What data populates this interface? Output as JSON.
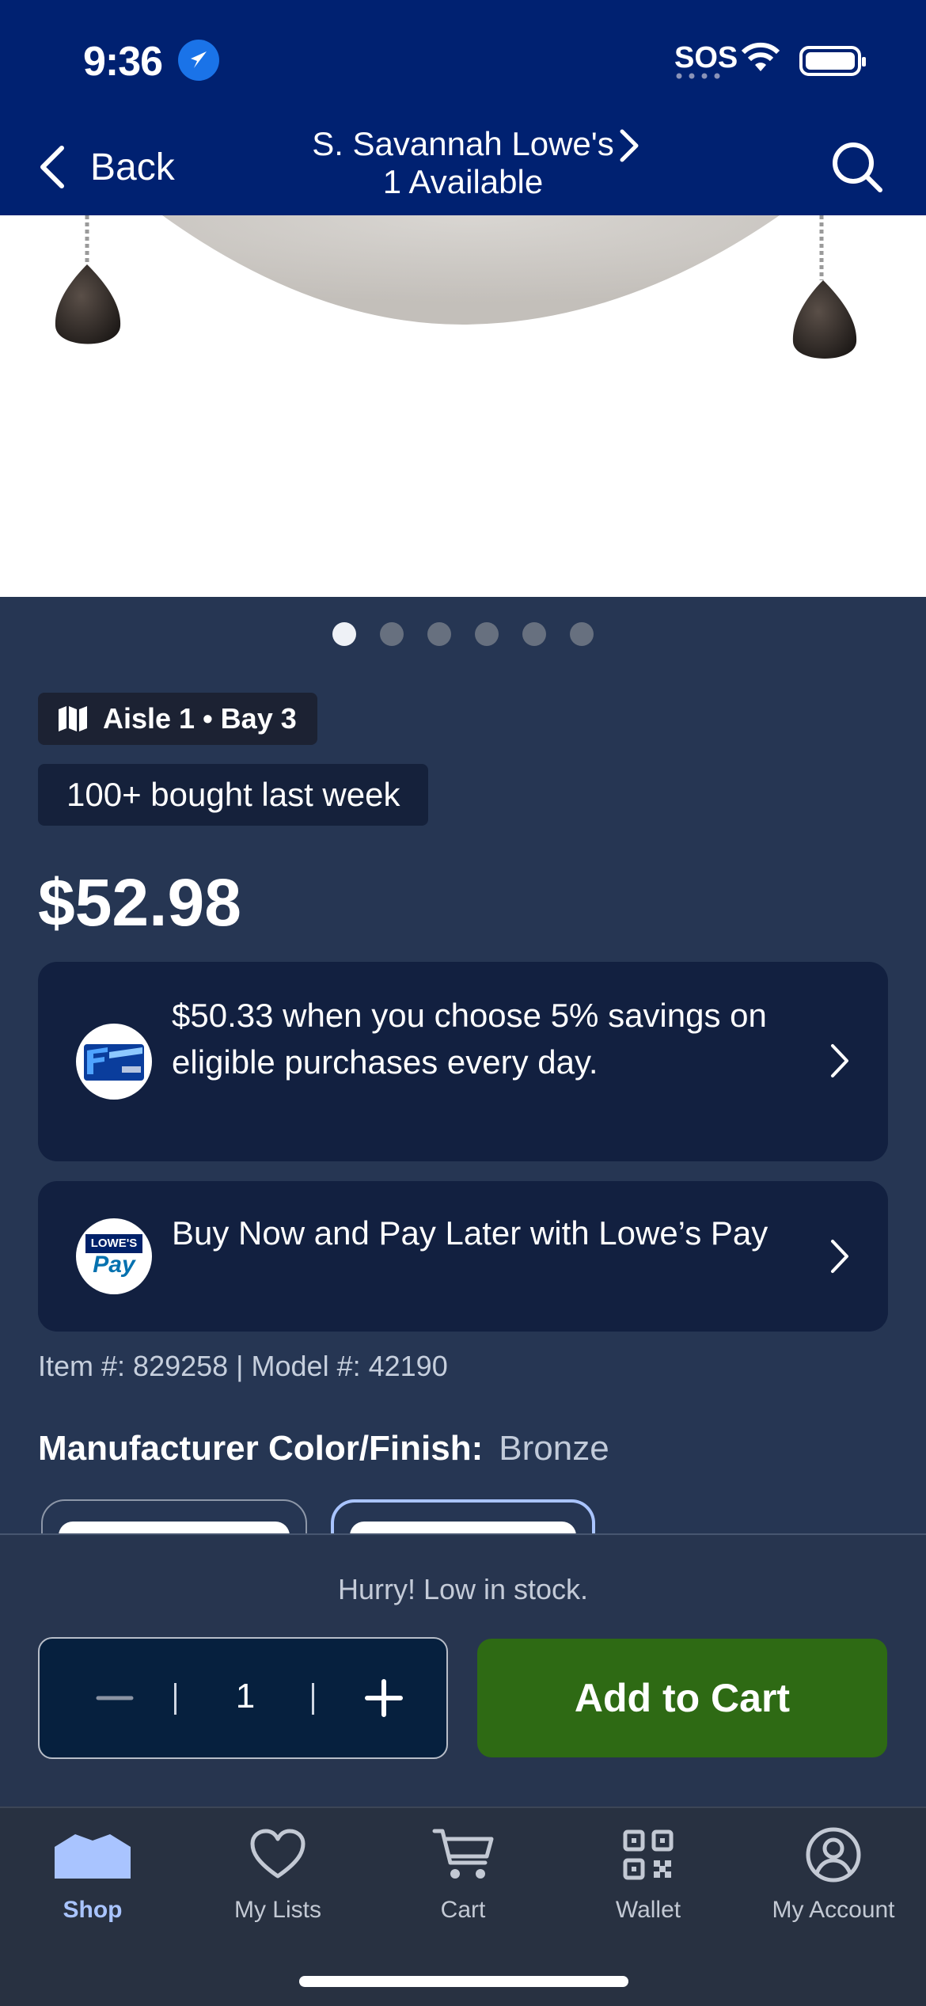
{
  "status_bar": {
    "time": "9:36",
    "sos": "SOS"
  },
  "header": {
    "back_label": "Back",
    "store_name": "S. Savannah Lowe's",
    "availability": "1 Available"
  },
  "gallery": {
    "total": 6,
    "active_index": 0
  },
  "product": {
    "location": "Aisle 1 • Bay 3",
    "social_proof": "100+ bought last week",
    "price": "$52.98",
    "offer_card": "$50.33 when you choose 5% savings on eligible purchases every day.",
    "pay_card": "Buy Now and Pay Later with Lowe’s Pay",
    "pay_logo_top": "LOWE'S",
    "pay_logo_bottom": "Pay",
    "item_info": "Item #: 829258 | Model #: 42190",
    "finish_label": "Manufacturer Color/Finish:",
    "finish_value": "Bronze"
  },
  "cart": {
    "stock_message": "Hurry! Low in stock.",
    "quantity": "1",
    "add_label": "Add to Cart"
  },
  "tabs": [
    {
      "label": "Shop",
      "icon": "shop-icon",
      "active": true
    },
    {
      "label": "My Lists",
      "icon": "heart-icon",
      "active": false
    },
    {
      "label": "Cart",
      "icon": "cart-icon",
      "active": false
    },
    {
      "label": "Wallet",
      "icon": "qr-code-icon",
      "active": false
    },
    {
      "label": "My Account",
      "icon": "account-icon",
      "active": false
    }
  ],
  "colors": {
    "header_bg": "#002171",
    "page_bg": "#263653",
    "card_bg": "#122040",
    "add_to_cart": "#2e6a14",
    "tab_active": "#a9c4ff"
  }
}
